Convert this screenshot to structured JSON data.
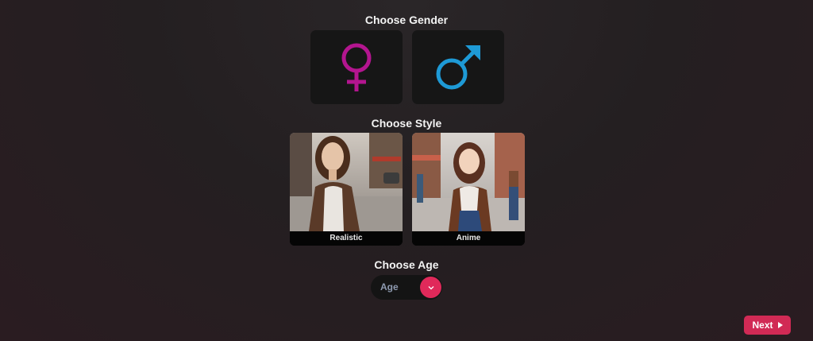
{
  "gender": {
    "title": "Choose Gender",
    "options": [
      {
        "icon": "female-symbol-icon",
        "color": "#b3158f"
      },
      {
        "icon": "male-symbol-icon",
        "color": "#1e9ad6"
      }
    ]
  },
  "style": {
    "title": "Choose Style",
    "options": [
      {
        "label": "Realistic",
        "image": "realistic-woman-street-photo"
      },
      {
        "label": "Anime",
        "image": "anime-woman-street-illustration"
      }
    ]
  },
  "age": {
    "title": "Choose Age",
    "select_value": "Age",
    "icon": "chevron-down-icon",
    "accent": "#e0295a"
  },
  "next": {
    "label": "Next",
    "icon": "caret-right-icon",
    "color": "#d12a55"
  }
}
